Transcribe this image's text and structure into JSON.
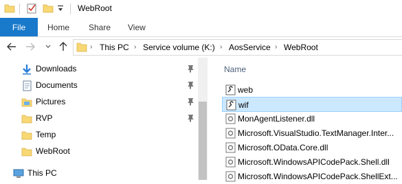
{
  "window": {
    "title": "WebRoot"
  },
  "ribbon": {
    "tabs": [
      "File",
      "Home",
      "Share",
      "View"
    ]
  },
  "address": {
    "crumbs": [
      "This PC",
      "Service volume (K:)",
      "AosService",
      "WebRoot"
    ]
  },
  "nav": {
    "items": [
      {
        "label": "Downloads",
        "icon": "download-arrow-icon",
        "pinned": true
      },
      {
        "label": "Documents",
        "icon": "documents-icon",
        "pinned": true
      },
      {
        "label": "Pictures",
        "icon": "pictures-icon",
        "pinned": true
      },
      {
        "label": "RVP",
        "icon": "folder-icon",
        "pinned": true
      },
      {
        "label": "Temp",
        "icon": "folder-icon",
        "pinned": false
      },
      {
        "label": "WebRoot",
        "icon": "folder-icon",
        "pinned": false
      },
      {
        "label": "This PC",
        "icon": "computer-icon",
        "pinned": false
      }
    ]
  },
  "content": {
    "column_header": "Name",
    "files": [
      {
        "name": "web",
        "icon": "config-file-icon",
        "selected": false
      },
      {
        "name": "wif",
        "icon": "config-file-icon",
        "selected": true
      },
      {
        "name": "MonAgentListener.dll",
        "icon": "dll-file-icon",
        "selected": false
      },
      {
        "name": "Microsoft.VisualStudio.TextManager.Inter...",
        "icon": "dll-file-icon",
        "selected": false
      },
      {
        "name": "Microsoft.OData.Core.dll",
        "icon": "dll-file-icon",
        "selected": false
      },
      {
        "name": "Microsoft.WindowsAPICodePack.Shell.dll",
        "icon": "dll-file-icon",
        "selected": false
      },
      {
        "name": "Microsoft.WindowsAPICodePack.ShellExt...",
        "icon": "dll-file-icon",
        "selected": false
      }
    ]
  },
  "colors": {
    "file_tab": "#1979ca",
    "selection": "#cce8ff",
    "folder": "#f8d775"
  }
}
